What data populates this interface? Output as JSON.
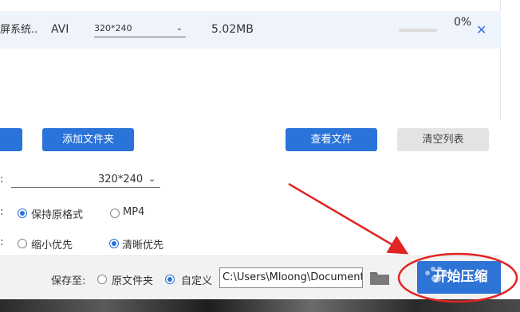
{
  "file_list": {
    "rows": [
      {
        "name": "屏系统...",
        "format": "AVI",
        "resolution": "320*240",
        "size": "5.02MB",
        "progress": 0,
        "progress_text": "0%",
        "remove_icon": "close-icon"
      }
    ]
  },
  "actions": {
    "add_folder": "添加文件夹",
    "view_files": "查看文件",
    "clear_list": "清空列表"
  },
  "settings": {
    "resolution_value": "320*240",
    "format_options": [
      "保持原格式",
      "MP4"
    ],
    "format_selected": "保持原格式",
    "quality_options": [
      "缩小优先",
      "清晰优先"
    ],
    "quality_selected": "清晰优先"
  },
  "save": {
    "label": "保存至:",
    "options": [
      "原文件夹",
      "自定义"
    ],
    "selected": "自定义",
    "path": "C:\\Users\\Mloong\\Documents",
    "folder_icon": "folder-icon"
  },
  "start_button": {
    "label": "开始压缩",
    "watermark_icon": "paw-watermark-icon"
  },
  "colors": {
    "primary": "#2a73d9",
    "row_highlight": "#eef3fc",
    "annotation": "#e02424"
  }
}
